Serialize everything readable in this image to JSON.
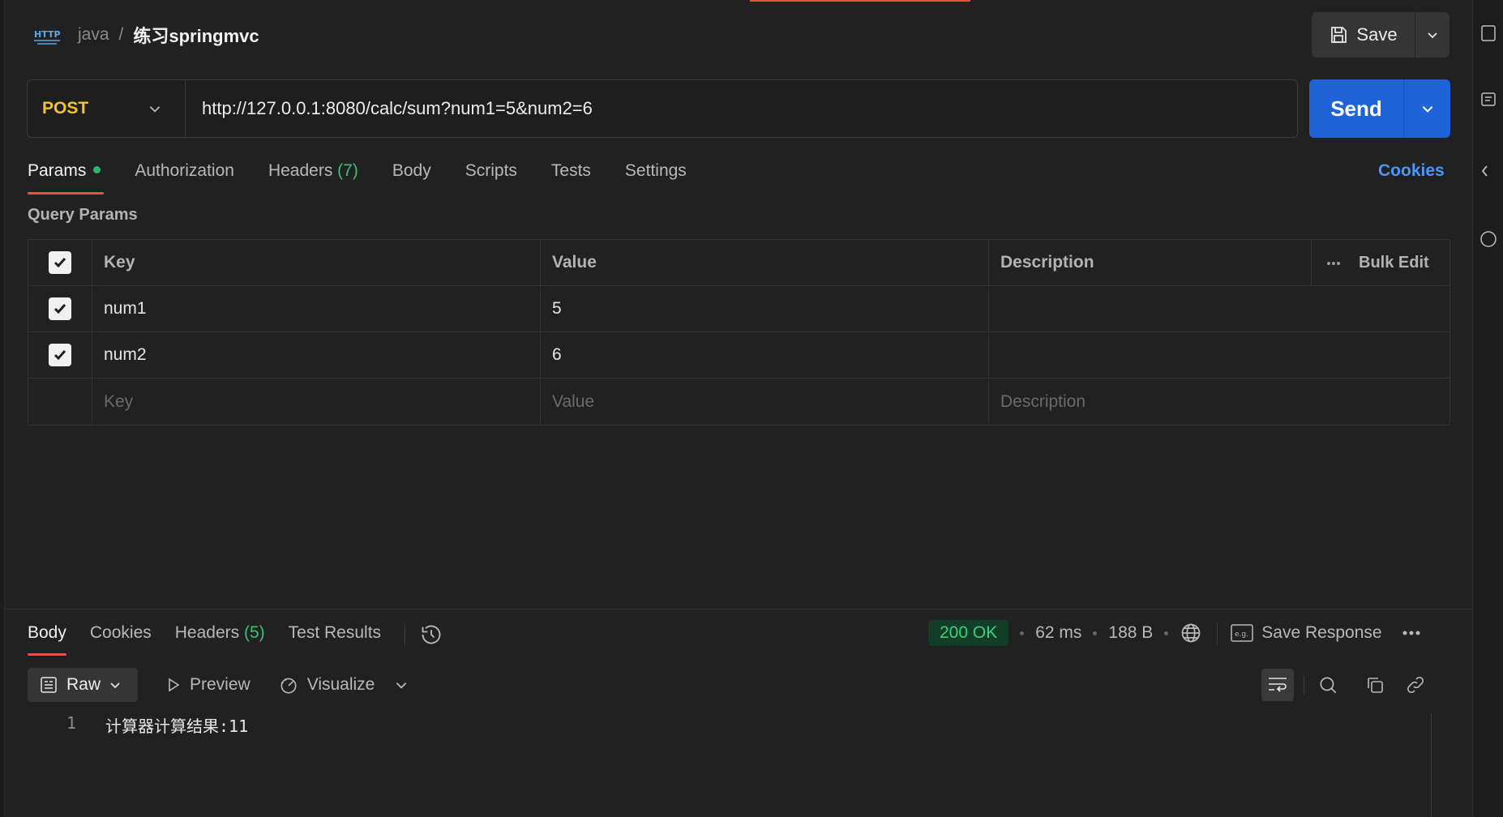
{
  "header": {
    "badge_icon": "http-icon",
    "collection": "java",
    "separator": "/",
    "request_name": "练习springmvc",
    "save_label": "Save"
  },
  "request": {
    "method": "POST",
    "url": "http://127.0.0.1:8080/calc/sum?num1=5&num2=6",
    "send_label": "Send"
  },
  "tabs": [
    {
      "label": "Params",
      "active": true,
      "indicator": "green-dot"
    },
    {
      "label": "Authorization"
    },
    {
      "label": "Headers",
      "count": "(7)"
    },
    {
      "label": "Body"
    },
    {
      "label": "Scripts"
    },
    {
      "label": "Tests"
    },
    {
      "label": "Settings"
    }
  ],
  "cookies_link": "Cookies",
  "query_params": {
    "title": "Query Params",
    "headers": {
      "key": "Key",
      "value": "Value",
      "description": "Description",
      "bulk_edit": "Bulk Edit"
    },
    "rows": [
      {
        "checked": true,
        "key": "num1",
        "value": "5",
        "description": ""
      },
      {
        "checked": true,
        "key": "num2",
        "value": "6",
        "description": ""
      }
    ],
    "placeholders": {
      "key": "Key",
      "value": "Value",
      "description": "Description"
    }
  },
  "response": {
    "tabs": [
      {
        "label": "Body",
        "active": true
      },
      {
        "label": "Cookies"
      },
      {
        "label": "Headers",
        "count": "(5)"
      },
      {
        "label": "Test Results"
      }
    ],
    "status": "200 OK",
    "time": "62 ms",
    "size": "188 B",
    "save_response": "Save Response",
    "format": "Raw",
    "preview": "Preview",
    "visualize": "Visualize",
    "body_lines": [
      {
        "line": "1",
        "text": "计算器计算结果:11"
      }
    ]
  },
  "colors": {
    "accent": "#e5533d",
    "send_blue": "#1f63d9",
    "method_yellow": "#f1c232",
    "status_green": "#3fcf7a",
    "link_blue": "#4b96ff"
  }
}
